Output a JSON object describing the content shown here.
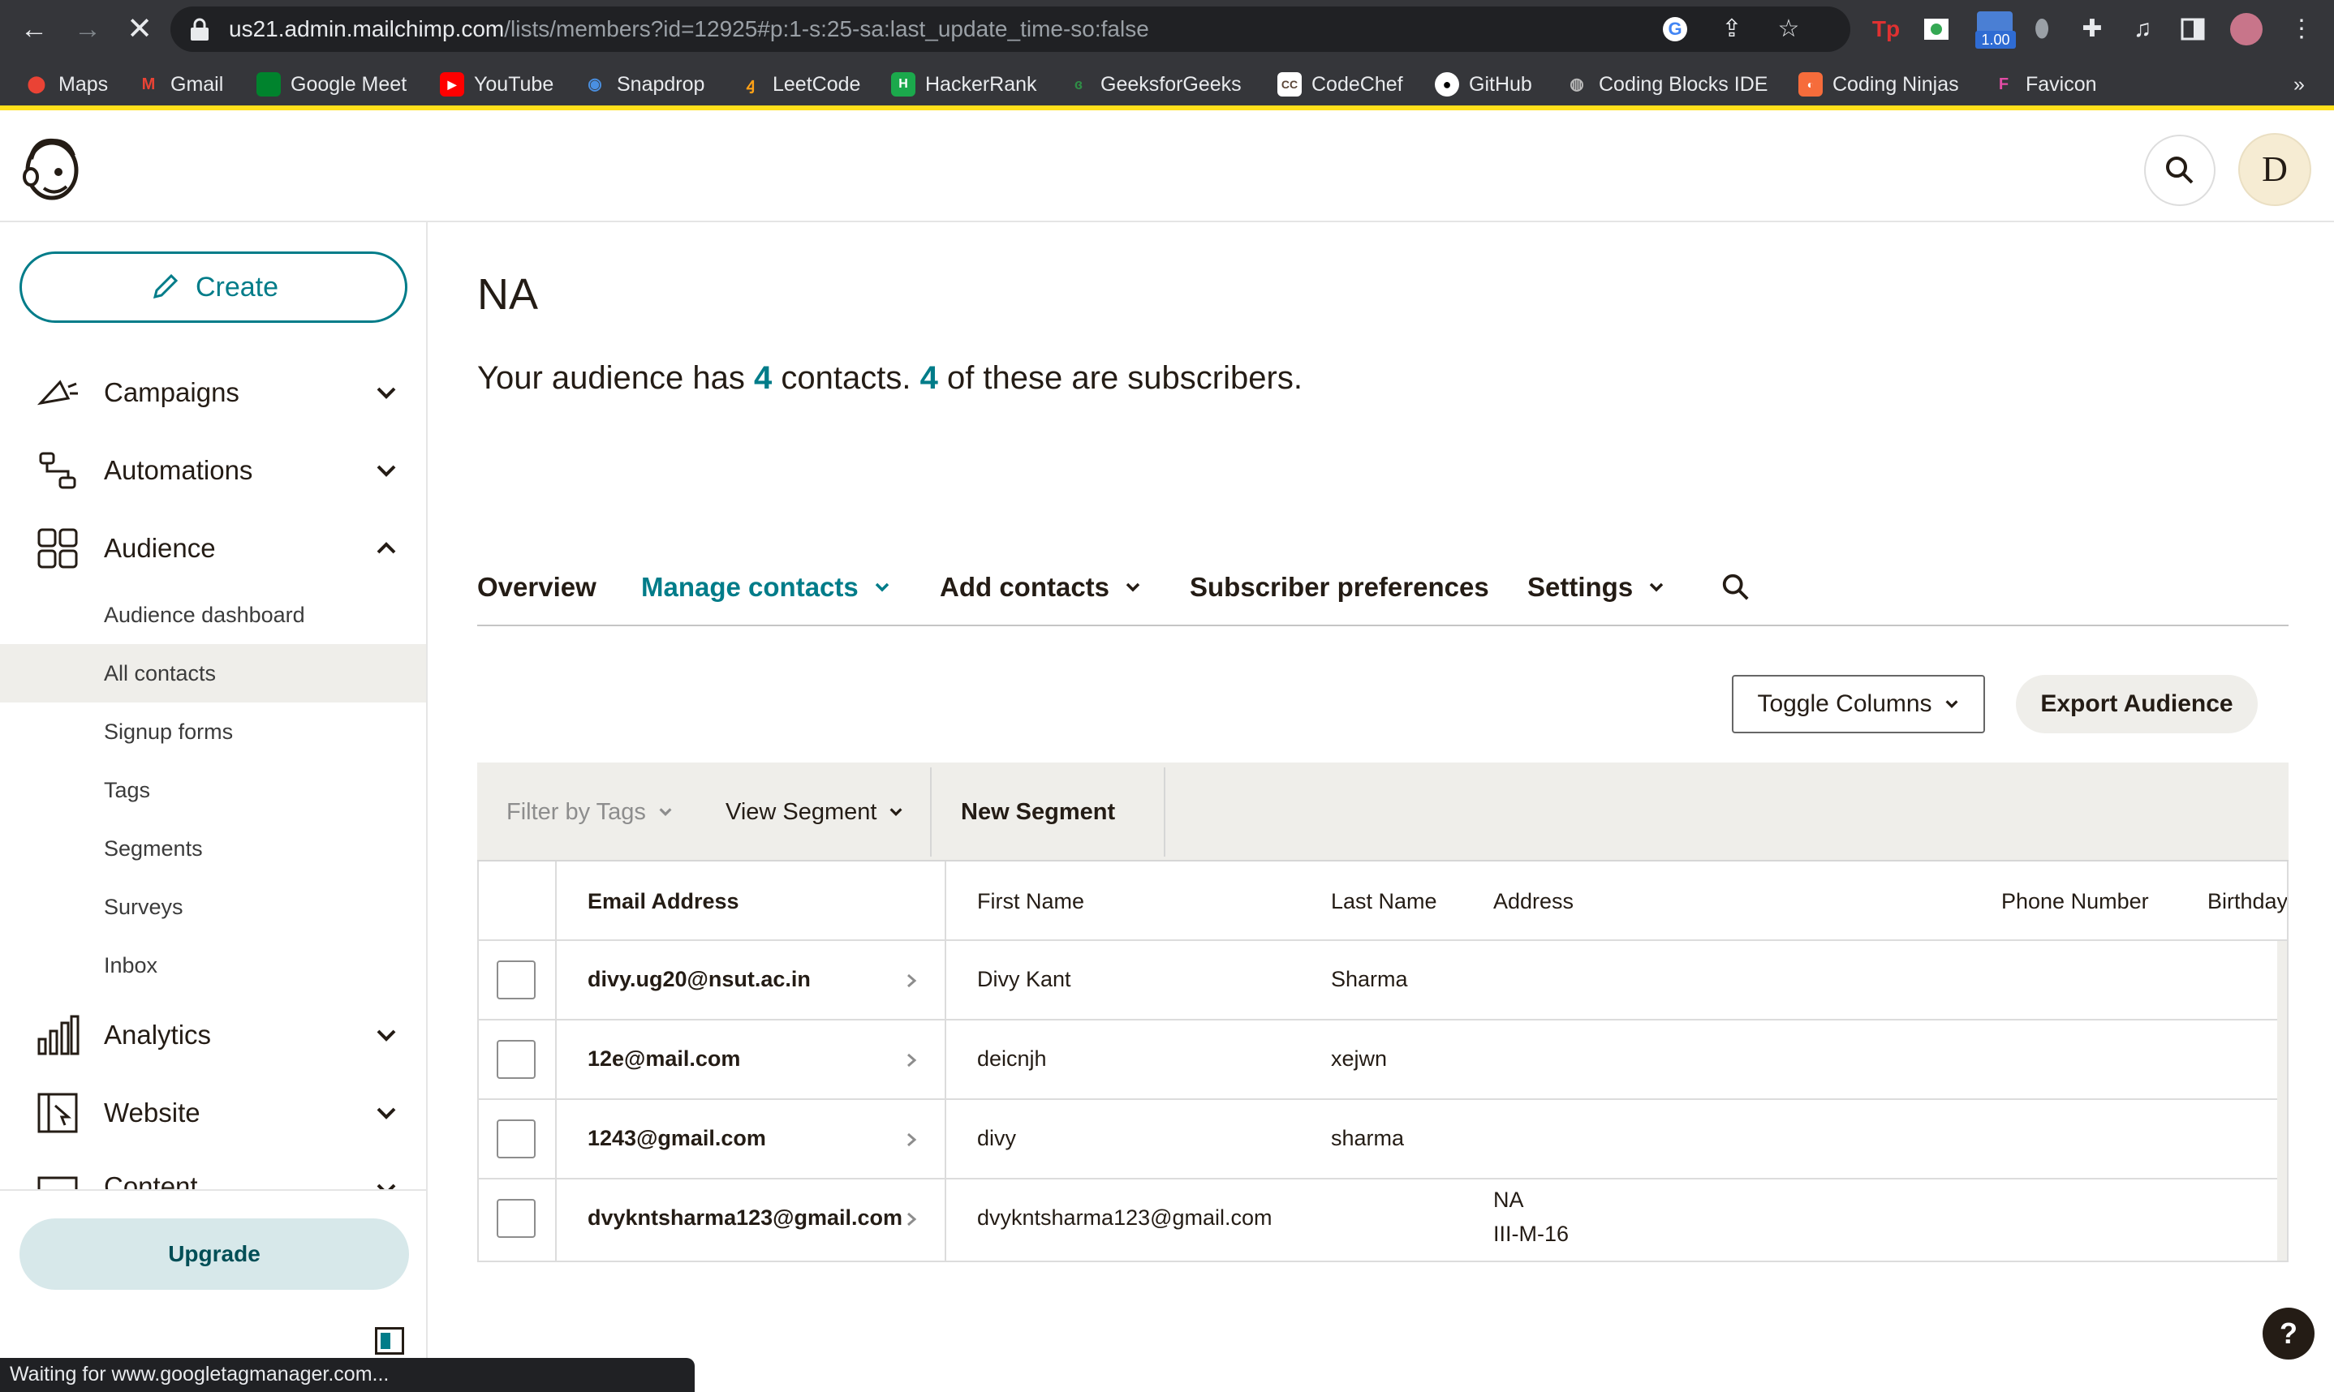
{
  "browser": {
    "url_host": "us21.admin.mailchimp.com",
    "url_path": "/lists/members?id=12925#p:1-s:25-sa:last_update_time-so:false",
    "status_text": "Waiting for www.googletagmanager.com...",
    "extension_badge": "1.00",
    "bookmarks": [
      "Maps",
      "Gmail",
      "Google Meet",
      "YouTube",
      "Snapdrop",
      "LeetCode",
      "HackerRank",
      "GeeksforGeeks",
      "CodeChef",
      "GitHub",
      "Coding Blocks IDE",
      "Coding Ninjas",
      "Favicon"
    ],
    "overflow_label": "»"
  },
  "header": {
    "avatar_initial": "D"
  },
  "sidebar": {
    "create_label": "Create",
    "nav": [
      {
        "label": "Campaigns"
      },
      {
        "label": "Automations"
      },
      {
        "label": "Audience"
      },
      {
        "label": "Analytics"
      },
      {
        "label": "Website"
      },
      {
        "label": "Content"
      }
    ],
    "audience_sub": [
      "Audience dashboard",
      "All contacts",
      "Signup forms",
      "Tags",
      "Segments",
      "Surveys",
      "Inbox"
    ],
    "active_sub": "All contacts",
    "upgrade_label": "Upgrade"
  },
  "main": {
    "title": "NA",
    "summary_pre": "Your audience has ",
    "contacts_count": "4",
    "summary_mid": " contacts. ",
    "subscribers_count": "4",
    "summary_post": " of these are subscribers.",
    "tabs": [
      "Overview",
      "Manage contacts",
      "Add contacts",
      "Subscriber preferences",
      "Settings"
    ],
    "toggle_columns_label": "Toggle Columns",
    "export_label": "Export Audience",
    "filter_tags_label": "Filter by Tags",
    "view_segment_label": "View Segment",
    "new_segment_label": "New Segment",
    "columns": [
      "Email Address",
      "First Name",
      "Last Name",
      "Address",
      "Phone Number",
      "Birthday"
    ],
    "rows": [
      {
        "email": "divy.ug20@nsut.ac.in",
        "first": "Divy Kant",
        "last": "Sharma",
        "address1": "",
        "address2": ""
      },
      {
        "email": "12e@mail.com",
        "first": "deicnjh",
        "last": "xejwn",
        "address1": "",
        "address2": ""
      },
      {
        "email": "1243@gmail.com",
        "first": "divy",
        "last": "sharma",
        "address1": "",
        "address2": ""
      },
      {
        "email": "dvykntsharma123@gmail.com",
        "first": "dvykntsharma123@gmail.com",
        "last": "",
        "address1": "NA",
        "address2": "III-M-16"
      }
    ]
  },
  "help_label": "?"
}
